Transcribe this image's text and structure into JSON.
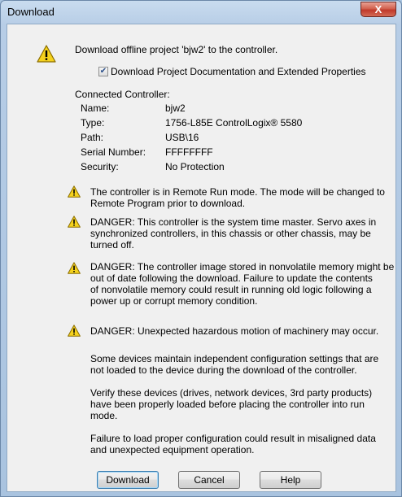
{
  "window": {
    "title": "Download",
    "close_glyph": "X"
  },
  "message": "Download offline project 'bjw2' to the controller.",
  "checkbox": {
    "label": "Download Project Documentation and Extended Properties",
    "checked": true
  },
  "controller": {
    "heading": "Connected Controller:",
    "rows": [
      {
        "label": "Name:",
        "value": "bjw2"
      },
      {
        "label": "Type:",
        "value": "1756-L85E ControlLogix® 5580"
      },
      {
        "label": "Path:",
        "value": "USB\\16"
      },
      {
        "label": "Serial Number:",
        "value": "FFFFFFFF"
      },
      {
        "label": "Security:",
        "value": "No Protection"
      }
    ]
  },
  "warnings": [
    {
      "lines": [
        "The controller is in Remote Run mode. The mode will be changed to",
        "Remote Program prior to download."
      ]
    },
    {
      "lines": [
        "DANGER: This controller is the system time master.  Servo axes in",
        "synchronized controllers, in this chassis or other chassis, may be",
        "turned off."
      ]
    },
    {
      "lines": [
        "DANGER: The controller image stored in nonvolatile memory might be",
        "out of date following the download. Failure to update the contents",
        "of nonvolatile memory could result in running old logic following a",
        "power up or corrupt memory condition."
      ]
    },
    {
      "lines": [
        "DANGER: Unexpected hazardous motion of machinery may occur."
      ]
    }
  ],
  "notes": [
    {
      "lines": [
        "Some devices maintain independent configuration settings that are",
        "not loaded to the device during the download of the controller."
      ]
    },
    {
      "lines": [
        "Verify these devices (drives, network devices, 3rd party products)",
        "have been properly loaded before placing the controller into run",
        "mode."
      ]
    },
    {
      "lines": [
        "Failure to load proper configuration could result in misaligned data",
        "and unexpected equipment operation."
      ]
    }
  ],
  "buttons": {
    "download": "Download",
    "cancel": "Cancel",
    "help": "Help"
  },
  "colors": {
    "warning_yellow": "#f5d21d",
    "warning_outline": "#8a6d00",
    "title_bar": "#b7cde6"
  },
  "icons": {
    "warning": "warning-triangle-icon",
    "close": "close-icon"
  }
}
